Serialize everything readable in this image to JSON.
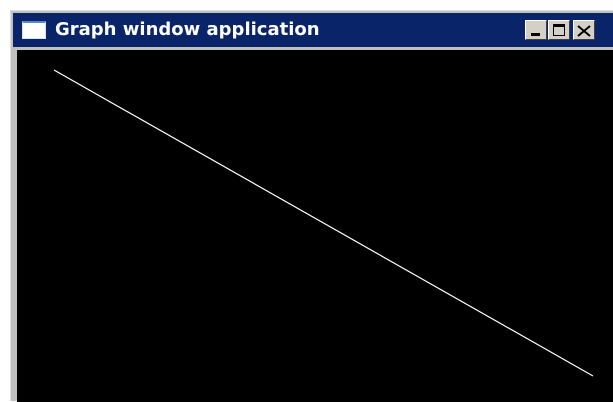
{
  "window": {
    "title": "Graph window application",
    "title_bar_color": "#0a246a",
    "canvas_background": "#000000",
    "line_color": "#ffffff",
    "controls": {
      "minimize": "minimize-icon",
      "maximize": "maximize-icon",
      "close": "close-icon"
    }
  }
}
